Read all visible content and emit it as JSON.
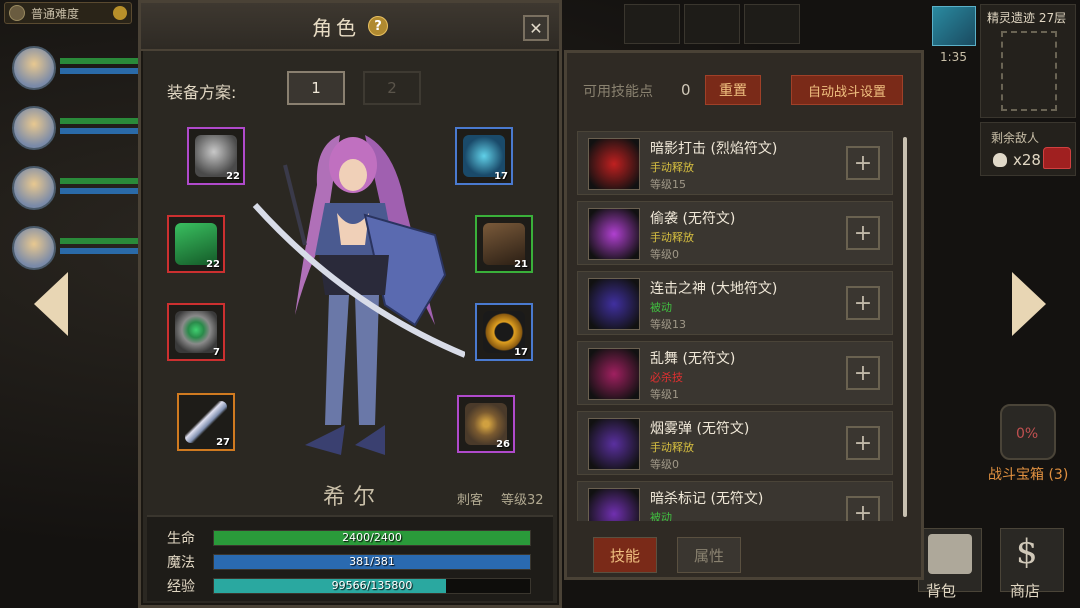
{
  "hud": {
    "difficulty": "普通难度",
    "timer": "1:35",
    "dungeon_name": "精灵遗迹 27层",
    "enemies_label": "剩余敌人",
    "enemies_count": "x28",
    "battle_chest_pct": "0%",
    "battle_chest_label": "战斗宝箱 (3)",
    "bag_label": "背包",
    "shop_label": "商店"
  },
  "character": {
    "title": "角色",
    "help": "?",
    "close": "✕",
    "equip_label": "装备方案:",
    "loadouts": [
      "1",
      "2"
    ],
    "name": "希尔",
    "class": "刺客",
    "level": "等级32",
    "equipment": [
      {
        "slot": "helmet",
        "level": "22",
        "rarity": "purple"
      },
      {
        "slot": "amulet",
        "level": "17",
        "rarity": "blue"
      },
      {
        "slot": "cloak",
        "level": "22",
        "rarity": "red"
      },
      {
        "slot": "boots",
        "level": "21",
        "rarity": "green"
      },
      {
        "slot": "ring",
        "level": "7",
        "rarity": "red"
      },
      {
        "slot": "ring2",
        "level": "17",
        "rarity": "blue"
      },
      {
        "slot": "weapon",
        "level": "27",
        "rarity": "orange"
      },
      {
        "slot": "offhand",
        "level": "26",
        "rarity": "purple"
      }
    ],
    "stats": {
      "hp_label": "生命",
      "hp_text": "2400/2400",
      "hp_ratio": 1.0,
      "mp_label": "魔法",
      "mp_text": "381/381",
      "mp_ratio": 1.0,
      "xp_label": "经验",
      "xp_text": "99566/135800",
      "xp_ratio": 0.733
    }
  },
  "skills": {
    "points_label": "可用技能点",
    "points_value": "0",
    "reset_label": "重置",
    "auto_label": "自动战斗设置",
    "tab_skills": "技能",
    "tab_attributes": "属性",
    "list": [
      {
        "name": "暗影打击 (烈焰符文)",
        "type": "手动释放",
        "type_color": "#d8c040",
        "level": "等级15",
        "icon_color": "#c02020"
      },
      {
        "name": "偷袭 (无符文)",
        "type": "手动释放",
        "type_color": "#d8c040",
        "level": "等级0",
        "icon_color": "#b040d0"
      },
      {
        "name": "连击之神 (大地符文)",
        "type": "被动",
        "type_color": "#40c040",
        "level": "等级13",
        "icon_color": "#4030a0"
      },
      {
        "name": "乱舞 (无符文)",
        "type": "必杀技",
        "type_color": "#e03030",
        "level": "等级1",
        "icon_color": "#a02060"
      },
      {
        "name": "烟雾弹 (无符文)",
        "type": "手动释放",
        "type_color": "#d8c040",
        "level": "等级0",
        "icon_color": "#5a30a0"
      },
      {
        "name": "暗杀标记 (无符文)",
        "type": "被动",
        "type_color": "#40c040",
        "level": "",
        "icon_color": "#7030b0"
      }
    ]
  },
  "colors": {
    "hp": "#2a9a3a",
    "mp": "#2a6ab0",
    "xp": "#2aa8a0",
    "accent_red": "#7a2a18"
  }
}
